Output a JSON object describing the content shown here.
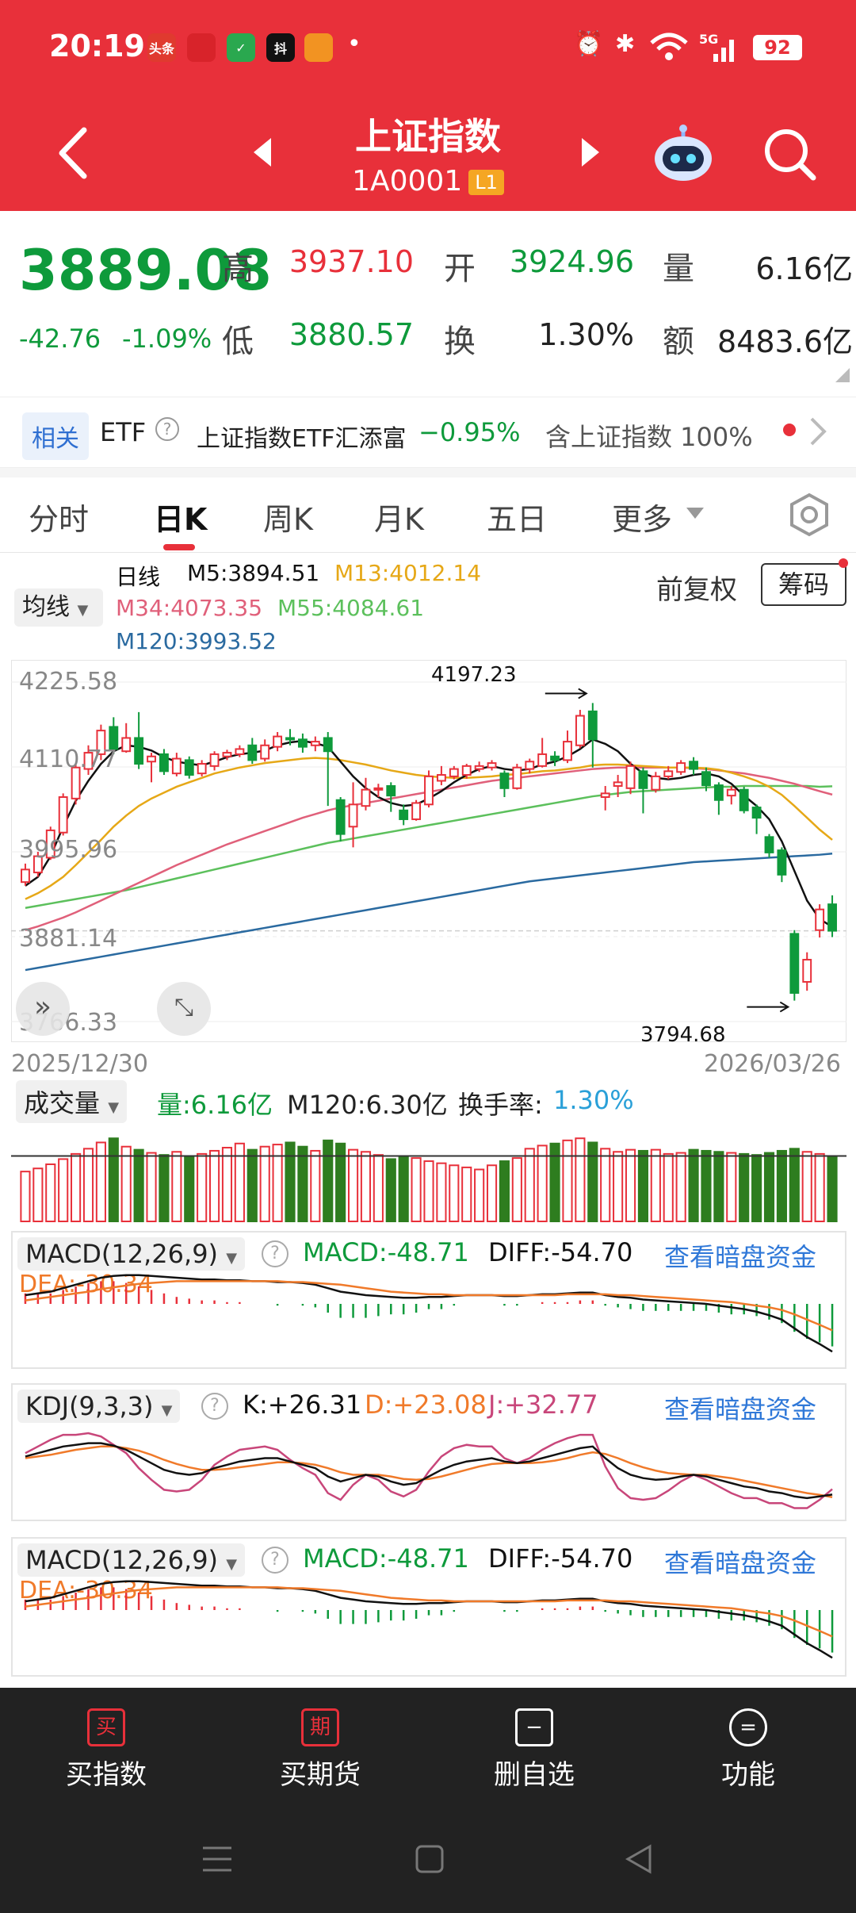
{
  "status_bar": {
    "time": "20:19",
    "apps": [
      "头条",
      "app",
      "app",
      "抖",
      "app",
      "•"
    ],
    "network": "5G",
    "battery": "92"
  },
  "header": {
    "title": "上证指数",
    "code": "1A0001",
    "level": "L1"
  },
  "quote": {
    "price": "3889.08",
    "change": "-42.76",
    "change_pct": "-1.09%",
    "high_label": "高",
    "high": "3937.10",
    "open_label": "开",
    "open": "3924.96",
    "vol_label": "量",
    "vol": "6.16亿",
    "low_label": "低",
    "low": "3880.57",
    "turnover_label": "换",
    "turnover": "1.30%",
    "amount_label": "额",
    "amount": "8483.6亿"
  },
  "etf": {
    "tag": "相关",
    "type": "ETF",
    "name": "上证指数ETF汇添富",
    "change": "−0.95%",
    "holding": "含上证指数 100%"
  },
  "tabs": [
    {
      "label": "分时"
    },
    {
      "label": "日K"
    },
    {
      "label": "周K"
    },
    {
      "label": "月K"
    },
    {
      "label": "五日"
    },
    {
      "label": "更多"
    }
  ],
  "kline": {
    "ma_button": "均线",
    "period": "日线",
    "m5": "M5:3894.51",
    "m13": "M13:4012.14",
    "m34": "M34:4073.35",
    "m55": "M55:4084.61",
    "m120": "M120:3993.52",
    "adjust": "前复权",
    "chips": "筹码",
    "yticks": [
      "4225.58",
      "4110.77",
      "3995.96",
      "3881.14",
      "3766.33"
    ],
    "date_start": "2025/12/30",
    "date_end": "2026/03/26",
    "high_mark": "4197.23",
    "low_mark": "3794.68"
  },
  "volume_panel": {
    "label": "成交量",
    "vol": "量:6.16亿",
    "m120": "M120:6.30亿",
    "turnover_label": "换手率:",
    "turnover": "1.30%"
  },
  "macd_panel": {
    "label": "MACD(12,26,9)",
    "macd": "MACD:-48.71",
    "diff": "DIFF:-54.70",
    "dea": "DEA:-30.34",
    "link": "查看暗盘资金"
  },
  "kdj_panel": {
    "label": "KDJ(9,3,3)",
    "k": "K:+26.31",
    "d": "D:+23.08",
    "j": "J:+32.77",
    "link": "查看暗盘资金"
  },
  "macd_panel2": {
    "label": "MACD(12,26,9)",
    "macd": "MACD:-48.71",
    "diff": "DIFF:-54.70",
    "dea": "DEA:-30.34",
    "link": "查看暗盘资金"
  },
  "bottom_nav": [
    {
      "label": "买指数",
      "icon": "买"
    },
    {
      "label": "买期货",
      "icon": "期"
    },
    {
      "label": "删自选",
      "icon": "−"
    },
    {
      "label": "功能",
      "icon": "="
    }
  ],
  "colors": {
    "up": "#e8303a",
    "down": "#0e9a3b",
    "header": "#e8303a",
    "m5": "#111111",
    "m13": "#e6a817",
    "m34": "#e0607a",
    "m55": "#5cc05c",
    "m120": "#2a6aa0"
  },
  "chart_data": {
    "type": "candlestick",
    "date_range": [
      "2025/12/30",
      "2026/03/26"
    ],
    "ylim": [
      3766.33,
      4225.58
    ],
    "candles": [
      {
        "o": 3955,
        "c": 3972,
        "h": 3980,
        "l": 3950
      },
      {
        "o": 3968,
        "c": 3990,
        "h": 3996,
        "l": 3962
      },
      {
        "o": 3988,
        "c": 4025,
        "h": 4030,
        "l": 3985
      },
      {
        "o": 4022,
        "c": 4070,
        "h": 4075,
        "l": 4018
      },
      {
        "o": 4068,
        "c": 4110,
        "h": 4116,
        "l": 4060
      },
      {
        "o": 4108,
        "c": 4130,
        "h": 4140,
        "l": 4100
      },
      {
        "o": 4128,
        "c": 4160,
        "h": 4168,
        "l": 4120
      },
      {
        "o": 4165,
        "c": 4135,
        "h": 4178,
        "l": 4128
      },
      {
        "o": 4132,
        "c": 4150,
        "h": 4170,
        "l": 4130
      },
      {
        "o": 4150,
        "c": 4115,
        "h": 4185,
        "l": 4108
      },
      {
        "o": 4118,
        "c": 4125,
        "h": 4130,
        "l": 4090
      },
      {
        "o": 4128,
        "c": 4105,
        "h": 4135,
        "l": 4100
      },
      {
        "o": 4102,
        "c": 4122,
        "h": 4130,
        "l": 4098
      },
      {
        "o": 4120,
        "c": 4100,
        "h": 4125,
        "l": 4095
      },
      {
        "o": 4102,
        "c": 4115,
        "h": 4120,
        "l": 4098
      },
      {
        "o": 4112,
        "c": 4128,
        "h": 4132,
        "l": 4106
      },
      {
        "o": 4125,
        "c": 4130,
        "h": 4134,
        "l": 4120
      },
      {
        "o": 4128,
        "c": 4135,
        "h": 4140,
        "l": 4124
      },
      {
        "o": 4140,
        "c": 4120,
        "h": 4150,
        "l": 4115
      },
      {
        "o": 4122,
        "c": 4140,
        "h": 4148,
        "l": 4118
      },
      {
        "o": 4138,
        "c": 4152,
        "h": 4158,
        "l": 4132
      },
      {
        "o": 4150,
        "c": 4148,
        "h": 4162,
        "l": 4140
      },
      {
        "o": 4148,
        "c": 4138,
        "h": 4156,
        "l": 4130
      },
      {
        "o": 4140,
        "c": 4145,
        "h": 4152,
        "l": 4132
      },
      {
        "o": 4150,
        "c": 4132,
        "h": 4158,
        "l": 4058
      },
      {
        "o": 4066,
        "c": 4020,
        "h": 4070,
        "l": 4010
      },
      {
        "o": 4030,
        "c": 4060,
        "h": 4090,
        "l": 4002
      },
      {
        "o": 4058,
        "c": 4080,
        "h": 4096,
        "l": 4052
      },
      {
        "o": 4080,
        "c": 4082,
        "h": 4088,
        "l": 4070
      },
      {
        "o": 4085,
        "c": 4072,
        "h": 4090,
        "l": 4050
      },
      {
        "o": 4052,
        "c": 4040,
        "h": 4060,
        "l": 4032
      },
      {
        "o": 4040,
        "c": 4062,
        "h": 4066,
        "l": 4038
      },
      {
        "o": 4060,
        "c": 4098,
        "h": 4106,
        "l": 4056
      },
      {
        "o": 4092,
        "c": 4100,
        "h": 4112,
        "l": 4086
      },
      {
        "o": 4098,
        "c": 4108,
        "h": 4112,
        "l": 4094
      },
      {
        "o": 4100,
        "c": 4112,
        "h": 4115,
        "l": 4095
      },
      {
        "o": 4108,
        "c": 4112,
        "h": 4118,
        "l": 4104
      },
      {
        "o": 4110,
        "c": 4116,
        "h": 4120,
        "l": 4106
      },
      {
        "o": 4102,
        "c": 4082,
        "h": 4106,
        "l": 4070
      },
      {
        "o": 4082,
        "c": 4110,
        "h": 4115,
        "l": 4080
      },
      {
        "o": 4108,
        "c": 4118,
        "h": 4122,
        "l": 4102
      },
      {
        "o": 4112,
        "c": 4128,
        "h": 4150,
        "l": 4110
      },
      {
        "o": 4125,
        "c": 4120,
        "h": 4132,
        "l": 4112
      },
      {
        "o": 4120,
        "c": 4145,
        "h": 4160,
        "l": 4116
      },
      {
        "o": 4140,
        "c": 4180,
        "h": 4188,
        "l": 4136
      },
      {
        "o": 4186,
        "c": 4148,
        "h": 4197.23,
        "l": 4110
      },
      {
        "o": 4070,
        "c": 4075,
        "h": 4085,
        "l": 4052
      },
      {
        "o": 4085,
        "c": 4090,
        "h": 4100,
        "l": 4070
      },
      {
        "o": 4082,
        "c": 4112,
        "h": 4118,
        "l": 4074
      },
      {
        "o": 4105,
        "c": 4082,
        "h": 4110,
        "l": 4048
      },
      {
        "o": 4080,
        "c": 4098,
        "h": 4104,
        "l": 4076
      },
      {
        "o": 4098,
        "c": 4105,
        "h": 4112,
        "l": 4094
      },
      {
        "o": 4104,
        "c": 4116,
        "h": 4120,
        "l": 4100
      },
      {
        "o": 4118,
        "c": 4108,
        "h": 4124,
        "l": 4100
      },
      {
        "o": 4104,
        "c": 4086,
        "h": 4110,
        "l": 4078
      },
      {
        "o": 4086,
        "c": 4066,
        "h": 4090,
        "l": 4046
      },
      {
        "o": 4072,
        "c": 4080,
        "h": 4085,
        "l": 4060
      },
      {
        "o": 4080,
        "c": 4052,
        "h": 4084,
        "l": 4048
      },
      {
        "o": 4056,
        "c": 4042,
        "h": 4060,
        "l": 4020
      },
      {
        "o": 4016,
        "c": 3995,
        "h": 4020,
        "l": 3988
      },
      {
        "o": 3998,
        "c": 3965,
        "h": 4002,
        "l": 3955
      },
      {
        "o": 3885,
        "c": 3805,
        "h": 3890,
        "l": 3794.68
      },
      {
        "o": 3820,
        "c": 3850,
        "h": 3860,
        "l": 3808
      },
      {
        "o": 3890,
        "c": 3918,
        "h": 3925,
        "l": 3880
      },
      {
        "o": 3924.96,
        "c": 3889.08,
        "h": 3937.1,
        "l": 3880.57
      }
    ],
    "ma": {
      "m5": [
        3950,
        3962,
        3990,
        4030,
        4065,
        4092,
        4115,
        4132,
        4140,
        4138,
        4133,
        4124,
        4118,
        4115,
        4113,
        4118,
        4124,
        4128,
        4130,
        4133,
        4140,
        4144,
        4146,
        4143,
        4138,
        4118,
        4098,
        4082,
        4070,
        4062,
        4058,
        4060,
        4068,
        4078,
        4090,
        4100,
        4108,
        4112,
        4108,
        4106,
        4108,
        4114,
        4118,
        4125,
        4135,
        4148,
        4142,
        4132,
        4115,
        4102,
        4096,
        4094,
        4096,
        4100,
        4102,
        4098,
        4088,
        4072,
        4058,
        4040,
        4010,
        3970,
        3930,
        3905,
        3894.51
      ],
      "m13": [
        3932,
        3940,
        3950,
        3962,
        3978,
        3995,
        4012,
        4030,
        4045,
        4058,
        4068,
        4076,
        4084,
        4090,
        4096,
        4102,
        4106,
        4110,
        4113,
        4116,
        4118,
        4120,
        4122,
        4123,
        4122,
        4120,
        4117,
        4114,
        4110,
        4106,
        4103,
        4100,
        4098,
        4097,
        4096,
        4096,
        4097,
        4098,
        4100,
        4101,
        4103,
        4105,
        4106,
        4108,
        4110,
        4113,
        4114,
        4114,
        4113,
        4112,
        4111,
        4110,
        4110,
        4110,
        4109,
        4107,
        4103,
        4098,
        4092,
        4084,
        4073,
        4058,
        4042,
        4026,
        4012.14
      ],
      "m34": [
        3890,
        3895,
        3901,
        3907,
        3914,
        3922,
        3930,
        3938,
        3946,
        3954,
        3962,
        3970,
        3978,
        3985,
        3992,
        3999,
        4006,
        4012,
        4018,
        4024,
        4030,
        4036,
        4042,
        4047,
        4052,
        4056,
        4059,
        4062,
        4065,
        4068,
        4071,
        4074,
        4077,
        4080,
        4083,
        4086,
        4089,
        4092,
        4094,
        4096,
        4098,
        4100,
        4102,
        4104,
        4106,
        4108,
        4109,
        4110,
        4110,
        4110,
        4110,
        4110,
        4110,
        4109,
        4108,
        4106,
        4104,
        4102,
        4099,
        4096,
        4092,
        4088,
        4083,
        4078,
        4073.35
      ],
      "m55": [
        3920,
        3923,
        3926,
        3929,
        3932,
        3935,
        3938,
        3941,
        3944,
        3948,
        3952,
        3956,
        3960,
        3964,
        3968,
        3972,
        3976,
        3980,
        3984,
        3988,
        3992,
        3996,
        4000,
        4004,
        4008,
        4011,
        4014,
        4017,
        4020,
        4023,
        4026,
        4029,
        4032,
        4035,
        4038,
        4041,
        4044,
        4047,
        4050,
        4053,
        4056,
        4059,
        4062,
        4065,
        4068,
        4071,
        4073,
        4075,
        4077,
        4078,
        4079,
        4080,
        4081,
        4082,
        4083,
        4084,
        4084,
        4085,
        4085,
        4085,
        4085,
        4085,
        4085,
        4084,
        4084.61
      ],
      "m120": [
        3836,
        3839,
        3842,
        3845,
        3848,
        3851,
        3854,
        3857,
        3860,
        3863,
        3866,
        3869,
        3872,
        3875,
        3878,
        3881,
        3884,
        3887,
        3890,
        3893,
        3896,
        3899,
        3902,
        3905,
        3908,
        3911,
        3914,
        3917,
        3920,
        3923,
        3926,
        3929,
        3932,
        3935,
        3938,
        3941,
        3944,
        3947,
        3950,
        3953,
        3956,
        3958,
        3960,
        3962,
        3964,
        3966,
        3968,
        3970,
        3972,
        3974,
        3976,
        3978,
        3980,
        3982,
        3983,
        3984,
        3985,
        3986,
        3987,
        3988,
        3989,
        3990,
        3991,
        3992,
        3993.52
      ]
    },
    "volume": [
      4.8,
      5.1,
      5.5,
      6.0,
      6.5,
      7.0,
      7.6,
      8.0,
      7.2,
      6.9,
      6.6,
      6.4,
      6.7,
      6.3,
      6.5,
      6.8,
      7.1,
      7.5,
      6.9,
      7.2,
      7.4,
      7.6,
      7.2,
      6.8,
      7.8,
      7.5,
      6.9,
      6.7,
      6.4,
      6.0,
      6.2,
      6.1,
      5.8,
      5.6,
      5.4,
      5.2,
      5.0,
      5.4,
      5.8,
      6.1,
      7.0,
      7.3,
      7.5,
      7.8,
      8.0,
      7.6,
      7.0,
      6.7,
      6.9,
      6.8,
      6.9,
      6.5,
      6.6,
      6.9,
      6.8,
      6.7,
      6.6,
      6.5,
      6.4,
      6.6,
      6.8,
      7.0,
      6.7,
      6.5,
      6.16
    ],
    "macd_diff": [
      10,
      12,
      14,
      18,
      22,
      26,
      30,
      32,
      33,
      33,
      32,
      31,
      30,
      29,
      28,
      28,
      27,
      27,
      26,
      26,
      25,
      25,
      24,
      22,
      18,
      14,
      12,
      10,
      9,
      8,
      7,
      7,
      8,
      8,
      9,
      10,
      10,
      10,
      9,
      9,
      10,
      11,
      11,
      12,
      13,
      13,
      10,
      8,
      7,
      5,
      4,
      3,
      2,
      1,
      0,
      -2,
      -4,
      -6,
      -9,
      -13,
      -18,
      -28,
      -38,
      -46,
      -54.7
    ],
    "macd_dea": [
      4,
      6,
      8,
      10,
      12,
      14,
      17,
      19,
      21,
      23,
      24,
      25,
      26,
      26,
      26,
      26,
      26,
      26,
      26,
      26,
      26,
      25,
      25,
      24,
      23,
      22,
      20,
      18,
      16,
      14,
      13,
      12,
      11,
      11,
      10,
      10,
      10,
      10,
      10,
      10,
      10,
      10,
      10,
      11,
      11,
      11,
      11,
      10,
      10,
      9,
      8,
      7,
      6,
      5,
      4,
      3,
      2,
      0,
      -2,
      -4,
      -7,
      -12,
      -18,
      -24,
      -30.34
    ],
    "kdj_k": [
      72,
      76,
      80,
      84,
      86,
      88,
      88,
      85,
      80,
      72,
      64,
      56,
      52,
      50,
      52,
      58,
      62,
      66,
      68,
      70,
      70,
      66,
      62,
      58,
      48,
      42,
      46,
      50,
      48,
      42,
      38,
      40,
      48,
      56,
      62,
      66,
      68,
      70,
      66,
      64,
      66,
      70,
      74,
      78,
      82,
      84,
      70,
      58,
      50,
      46,
      44,
      45,
      48,
      50,
      48,
      44,
      40,
      36,
      34,
      30,
      28,
      24,
      22,
      24,
      26.31
    ],
    "kdj_d": [
      70,
      72,
      74,
      77,
      80,
      82,
      84,
      84,
      82,
      79,
      74,
      68,
      63,
      59,
      56,
      56,
      57,
      59,
      61,
      63,
      65,
      65,
      64,
      62,
      58,
      53,
      50,
      50,
      50,
      48,
      45,
      44,
      45,
      48,
      52,
      56,
      60,
      63,
      64,
      64,
      64,
      65,
      67,
      70,
      74,
      77,
      75,
      70,
      64,
      59,
      55,
      52,
      51,
      50,
      50,
      48,
      46,
      43,
      40,
      37,
      34,
      31,
      28,
      26,
      23.08
    ],
    "kdj_j": [
      76,
      84,
      92,
      98,
      98,
      100,
      96,
      86,
      76,
      58,
      44,
      32,
      30,
      32,
      44,
      62,
      72,
      80,
      82,
      84,
      80,
      68,
      58,
      50,
      28,
      20,
      38,
      50,
      44,
      30,
      24,
      32,
      54,
      72,
      82,
      86,
      84,
      84,
      70,
      64,
      70,
      80,
      88,
      94,
      98,
      98,
      60,
      34,
      22,
      20,
      22,
      31,
      42,
      50,
      44,
      36,
      28,
      22,
      22,
      16,
      16,
      10,
      10,
      20,
      32.77
    ]
  }
}
